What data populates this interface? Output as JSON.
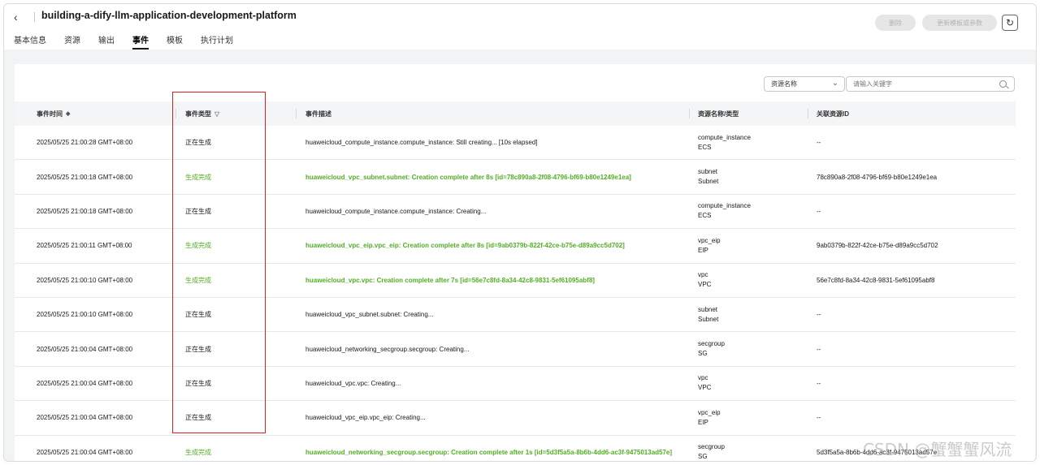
{
  "header": {
    "back_icon": "‹",
    "title": "building-a-dify-llm-application-development-platform",
    "delete_label": "删除",
    "update_label": "更新模板或参数",
    "refresh_icon": "↻"
  },
  "tabs": [
    {
      "label": "基本信息"
    },
    {
      "label": "资源"
    },
    {
      "label": "输出"
    },
    {
      "label": "事件",
      "active": true
    },
    {
      "label": "模板"
    },
    {
      "label": "执行计划"
    }
  ],
  "filter": {
    "select_value": "资源名称",
    "search_placeholder": "请输入关键字"
  },
  "table": {
    "headers": {
      "time": "事件时间",
      "type": "事件类型",
      "desc": "事件描述",
      "res": "资源名称/类型",
      "rid": "关联资源ID"
    },
    "rows": [
      {
        "time": "2025/05/25 21:00:28 GMT+08:00",
        "type": "正在生成",
        "desc": "huaweicloud_compute_instance.compute_instance: Still creating... [10s elapsed]",
        "res_name": "compute_instance",
        "res_type": "ECS",
        "rid": "--",
        "status": "progress"
      },
      {
        "time": "2025/05/25 21:00:18 GMT+08:00",
        "type": "生成完成",
        "desc": "huaweicloud_vpc_subnet.subnet: Creation complete after 8s [id=78c890a8-2f08-4796-bf69-b80e1249e1ea]",
        "res_name": "subnet",
        "res_type": "Subnet",
        "rid": "78c890a8-2f08-4796-bf69-b80e1249e1ea",
        "status": "done"
      },
      {
        "time": "2025/05/25 21:00:18 GMT+08:00",
        "type": "正在生成",
        "desc": "huaweicloud_compute_instance.compute_instance: Creating...",
        "res_name": "compute_instance",
        "res_type": "ECS",
        "rid": "--",
        "status": "progress"
      },
      {
        "time": "2025/05/25 21:00:11 GMT+08:00",
        "type": "生成完成",
        "desc": "huaweicloud_vpc_eip.vpc_eip: Creation complete after 8s [id=9ab0379b-822f-42ce-b75e-d89a9cc5d702]",
        "res_name": "vpc_eip",
        "res_type": "EIP",
        "rid": "9ab0379b-822f-42ce-b75e-d89a9cc5d702",
        "status": "done"
      },
      {
        "time": "2025/05/25 21:00:10 GMT+08:00",
        "type": "生成完成",
        "desc": "huaweicloud_vpc.vpc: Creation complete after 7s [id=56e7c8fd-8a34-42c8-9831-5ef61095abf8]",
        "res_name": "vpc",
        "res_type": "VPC",
        "rid": "56e7c8fd-8a34-42c8-9831-5ef61095abf8",
        "status": "done"
      },
      {
        "time": "2025/05/25 21:00:10 GMT+08:00",
        "type": "正在生成",
        "desc": "huaweicloud_vpc_subnet.subnet: Creating...",
        "res_name": "subnet",
        "res_type": "Subnet",
        "rid": "--",
        "status": "progress"
      },
      {
        "time": "2025/05/25 21:00:04 GMT+08:00",
        "type": "正在生成",
        "desc": "huaweicloud_networking_secgroup.secgroup: Creating...",
        "res_name": "secgroup",
        "res_type": "SG",
        "rid": "--",
        "status": "progress"
      },
      {
        "time": "2025/05/25 21:00:04 GMT+08:00",
        "type": "正在生成",
        "desc": "huaweicloud_vpc.vpc: Creating...",
        "res_name": "vpc",
        "res_type": "VPC",
        "rid": "--",
        "status": "progress"
      },
      {
        "time": "2025/05/25 21:00:04 GMT+08:00",
        "type": "正在生成",
        "desc": "huaweicloud_vpc_eip.vpc_eip: Creating...",
        "res_name": "vpc_eip",
        "res_type": "EIP",
        "rid": "--",
        "status": "progress"
      },
      {
        "time": "2025/05/25 21:00:04 GMT+08:00",
        "type": "生成完成",
        "desc": "huaweicloud_networking_secgroup.secgroup: Creation complete after 1s [id=5d3f5a5a-8b6b-4dd6-ac3f-9475013ad57e]",
        "res_name": "secgroup",
        "res_type": "SG",
        "rid": "5d3f5a5a-8b6b-4dd6-ac3f-9475013ad57e",
        "status": "done"
      }
    ]
  },
  "colors": {
    "success": "#52ae24",
    "highlight_box": "#e02020"
  },
  "watermark": "CSDN @蟹蟹蟹风流"
}
